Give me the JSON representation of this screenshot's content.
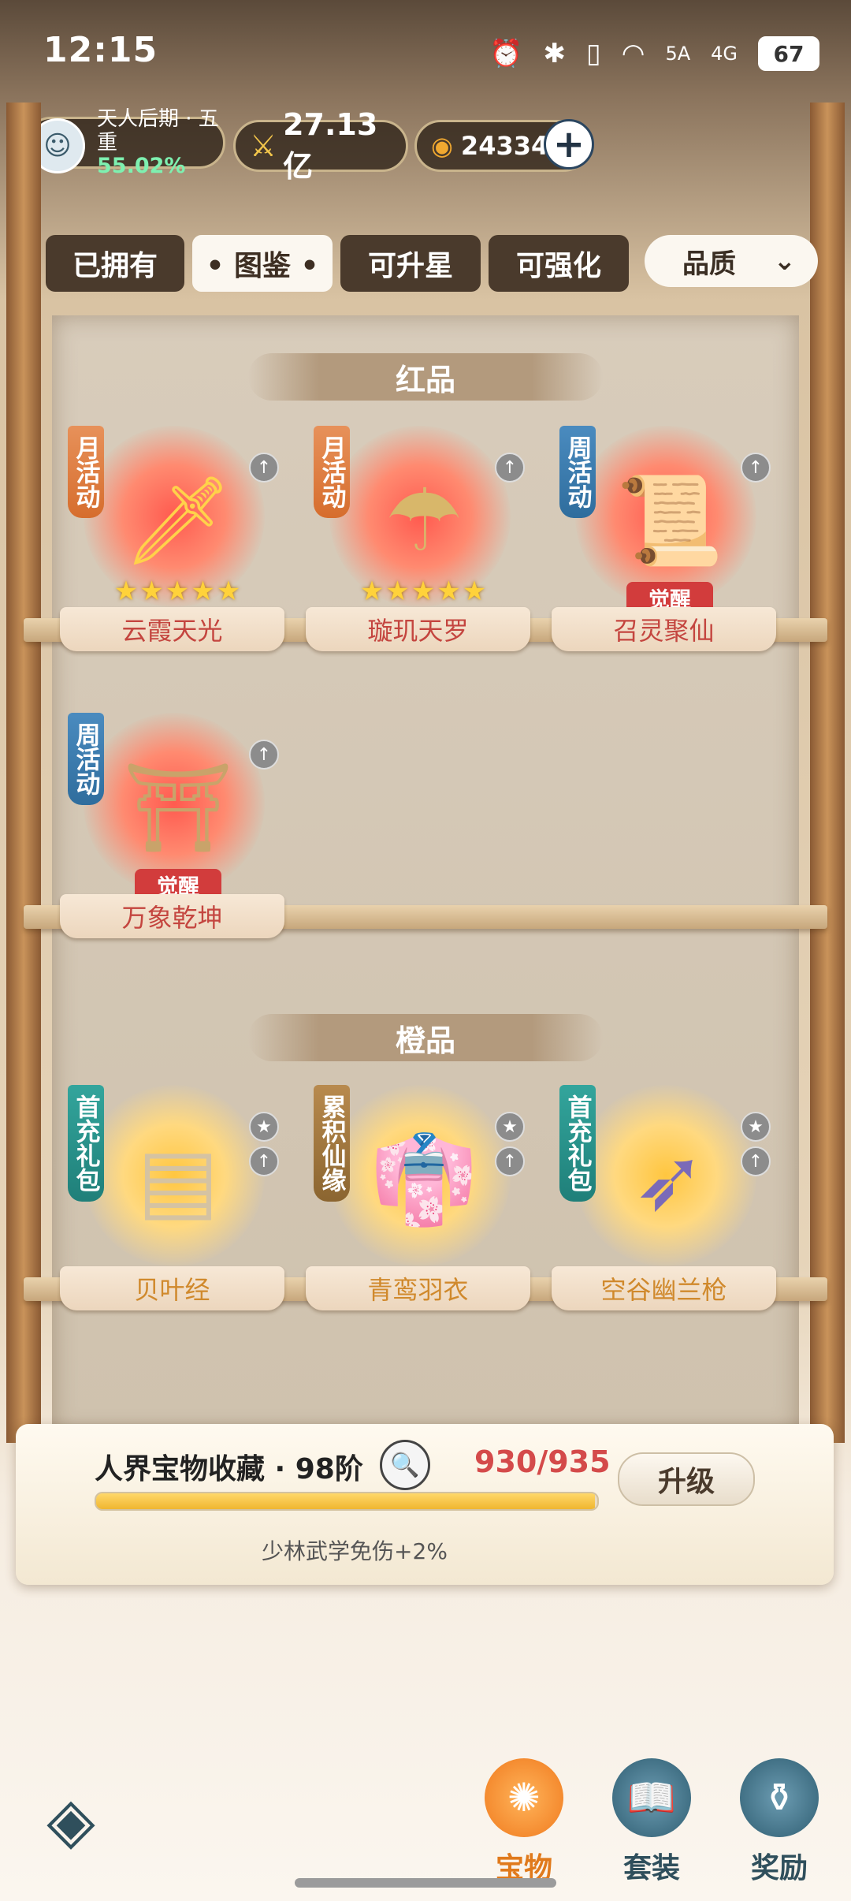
{
  "status_bar": {
    "time": "12:15",
    "signal_5g": "5A",
    "signal_4g": "4G",
    "battery": "67"
  },
  "resources": {
    "rank": "天人后期 · 五重",
    "rank_progress": "55.02%",
    "power": "27.13亿",
    "currency": "24334"
  },
  "tabs": [
    {
      "label": "已拥有"
    },
    {
      "label": "• 图鉴 •",
      "active": true
    },
    {
      "label": "可升星"
    },
    {
      "label": "可强化"
    }
  ],
  "filter": {
    "label": "品质"
  },
  "sections": {
    "red": {
      "title": "红品",
      "items": [
        {
          "name": "云霞天光",
          "tag": "月活动",
          "stars": "★★★★★"
        },
        {
          "name": "璇玑天罗",
          "tag": "月活动",
          "stars": "★★★★★"
        },
        {
          "name": "召灵聚仙",
          "tag": "周活动",
          "status": "觉醒"
        },
        {
          "name": "万象乾坤",
          "tag": "周活动",
          "status": "觉醒"
        }
      ]
    },
    "orange": {
      "title": "橙品",
      "items": [
        {
          "name": "贝叶经",
          "tag": "首充礼包"
        },
        {
          "name": "青鸾羽衣",
          "tag": "累积仙缘"
        },
        {
          "name": "空谷幽兰枪",
          "tag": "首充礼包"
        }
      ]
    }
  },
  "collection": {
    "title": "人界宝物收藏 · 98阶",
    "count": "930/935",
    "progress": 0.9947,
    "upgrade_label": "升级",
    "bonus": "少林武学免伤+2%"
  },
  "bottom_nav": [
    {
      "label": "宝物",
      "active": true
    },
    {
      "label": "套装"
    },
    {
      "label": "奖励"
    }
  ],
  "colors": {
    "red_glow": "#ff5a4f",
    "orange_glow": "#ffc640",
    "count_red": "#d44a4a"
  }
}
